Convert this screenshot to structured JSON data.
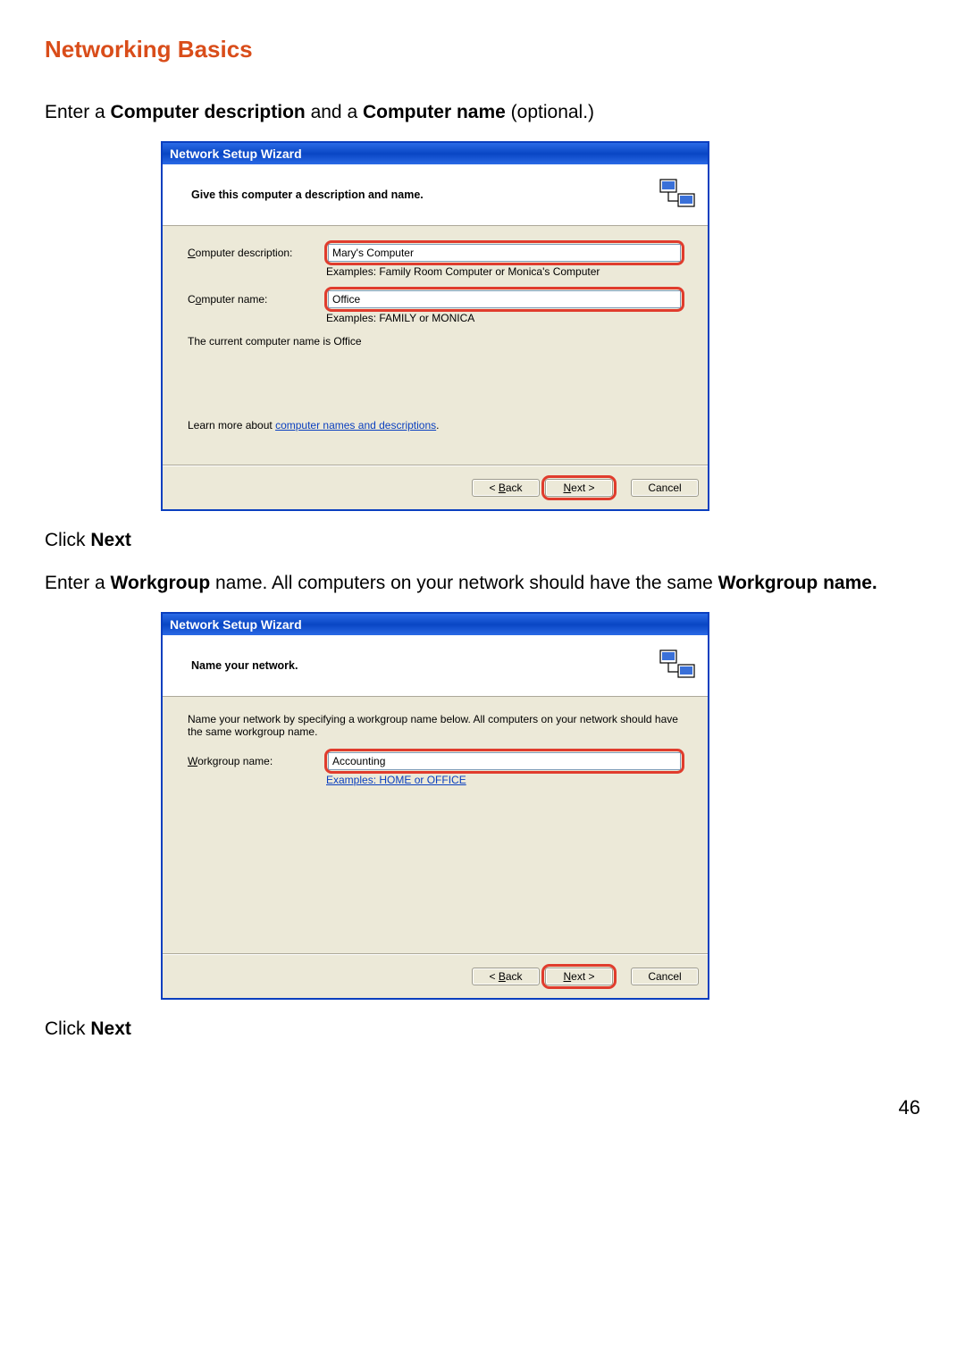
{
  "page": {
    "section_title": "Networking Basics",
    "instr1_prefix": "Enter a ",
    "instr1_b1": "Computer description",
    "instr1_mid": " and a ",
    "instr1_b2": "Computer name",
    "instr1_suffix": " (optional.)",
    "click1_prefix": "Click ",
    "click1_bold": "Next",
    "instr2_prefix": "Enter a ",
    "instr2_b1": "Workgroup",
    "instr2_mid": " name.  All computers on your network should have the same ",
    "instr2_b2": "Workgroup name.",
    "click2_prefix": "Click ",
    "click2_bold": "Next",
    "page_number": "46"
  },
  "wizard1": {
    "title": "Network Setup Wizard",
    "header": "Give this computer a description and name.",
    "desc_label_pre": "C",
    "desc_label_post": "omputer description:",
    "desc_value": "Mary's Computer",
    "desc_example": "Examples: Family Room Computer or Monica's Computer",
    "name_label_pre": "C",
    "name_label_u": "o",
    "name_label_post": "mputer name:",
    "name_value": "Office",
    "name_example": "Examples: FAMILY or MONICA",
    "current_name_prefix": "The current computer name is   ",
    "current_name_value": "Office",
    "learn_pre": "Learn more about ",
    "learn_link": "computer names and descriptions",
    "learn_post": ".",
    "btn_back": "< Back",
    "btn_next": "Next >",
    "btn_cancel": "Cancel"
  },
  "wizard2": {
    "title": "Network Setup Wizard",
    "header": "Name your network.",
    "desc": "Name your network by specifying a workgroup name below. All computers on your network should have the same workgroup name.",
    "wg_label_u": "W",
    "wg_label_post": "orkgroup name:",
    "wg_value": "Accounting",
    "wg_example": "Examples: HOME or OFFICE",
    "btn_back": "< Back",
    "btn_next": "Next >",
    "btn_cancel": "Cancel"
  }
}
